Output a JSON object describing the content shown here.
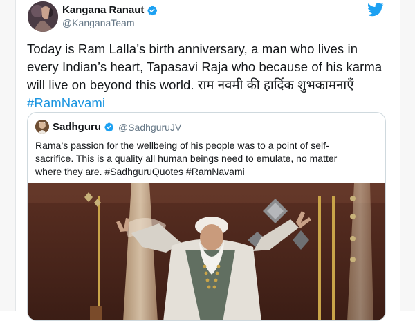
{
  "tweet": {
    "author_name": "Kangana Ranaut",
    "author_handle": "@KanganaTeam",
    "text_lines": [
      "Today is Ram Lalla’s birth anniversary, a man who lives in",
      "every Indian’s heart, Tapasavi Raja who because of his karma",
      "will live on beyond this world. राम नवमी की हार्दिक शुभकामनाएँ"
    ],
    "hashtag": "#RamNavami"
  },
  "quoted_tweet": {
    "author_name": "Sadhguru",
    "author_handle": "@SadhguruJV",
    "text_lines": [
      "Rama’s passion for the wellbeing of his people was to a point of self-",
      "sacrifice. This is a quality all human beings need to emulate, no matter",
      "where they are. #SadhguruQuotes #RamNavami"
    ]
  },
  "icons": {
    "verified": "verified-badge-icon",
    "brand": "twitter-bird-icon"
  },
  "colors": {
    "accent": "#1da1f2",
    "hashtag": "#1b95e0",
    "secondary_text": "#657786",
    "border": "#cfd9de"
  }
}
